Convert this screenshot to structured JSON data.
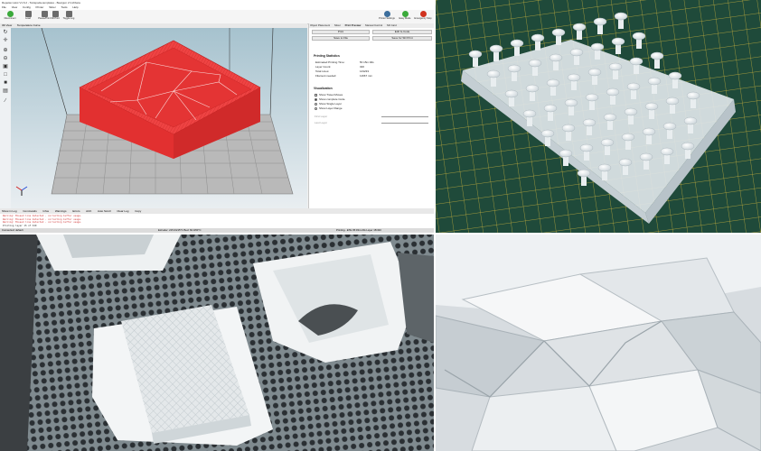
{
  "app": {
    "title": "Repetier-Host V1.6.2 - Tetrapoda-templates - Beargun 2 Inchbeta",
    "menu": [
      "File",
      "View",
      "Config",
      "Printer",
      "Slicer",
      "Tools",
      "Help"
    ],
    "toolbar": [
      {
        "label": "Disconnect",
        "icon": "power-icon",
        "color": "#3aa93a"
      },
      {
        "label": "Load",
        "icon": "folder-icon",
        "color": "#5a5a5a"
      },
      {
        "label": "Pause/Print",
        "icon": "pause-icon",
        "color": "#5a5a5a"
      },
      {
        "label": "Kill Print",
        "icon": "stop-icon",
        "color": "#5a5a5a"
      },
      {
        "label": "Toggle Log",
        "icon": "log-icon",
        "color": "#5a5a5a"
      }
    ],
    "toolbar_right": [
      {
        "label": "Printer Settings",
        "icon": "gear-icon",
        "color": "#3c6e9c"
      },
      {
        "label": "Easy Mode",
        "icon": "easy-icon",
        "color": "#3aa93a"
      },
      {
        "label": "Emergency Stop",
        "icon": "emergency-icon",
        "color": "#d0321e"
      }
    ],
    "view_tabs": [
      "3D View",
      "Temperature Curve"
    ],
    "side_tools": [
      "rotate-icon",
      "move-icon",
      "zoom-in-icon",
      "zoom-out-icon",
      "fit-icon",
      "top-view-icon",
      "front-view-icon",
      "side-view-icon",
      "parallel-icon"
    ],
    "right_tabs": [
      "Object Placement",
      "Slicer",
      "Print Preview",
      "Manual Control",
      "SD Card"
    ],
    "buttons": {
      "print": "Print",
      "edit_gcode": "Edit G-Code",
      "save_file": "Save to File",
      "save_sd": "Save for SD Print"
    },
    "stats": {
      "heading": "Printing Statistics",
      "rows": [
        {
          "label": "Estimated Printing Time:",
          "value": "5h:15m:40s"
        },
        {
          "label": "Layer Count:",
          "value": "320"
        },
        {
          "label": "Total Lines:",
          "value": "143233"
        },
        {
          "label": "Filament needed:",
          "value": "11667 mm"
        }
      ]
    },
    "visualization": {
      "heading": "Visualization",
      "options": [
        "Show Travel Moves",
        "Show complete Code",
        "Show Single Layer",
        "Show Layer Range"
      ],
      "first_layer": "First Layer",
      "last_layer": "Last Layer"
    },
    "log_tabs": [
      "Show in Log",
      "Commands",
      "Infos",
      "Warnings",
      "Errors",
      "ACK",
      "Auto Scroll",
      "Clear Log",
      "Copy"
    ],
    "log_lines": [
      "Warning: Missed line detected - correcting buffer usage.",
      "Warning: Missed line detected - correcting buffer usage.",
      "Warning: Missed line detected - correcting buffer usage.",
      "Printing layer 15 of 320"
    ],
    "status": {
      "connection": "Connected: default",
      "temps": "Extruder: 215.0/215°C Bed: 60.0/60°C",
      "progress": "Printing...ETE 05:03m:20s Layer 15/320"
    }
  },
  "colors": {
    "model": "#f03c3c",
    "model_dark": "#c62424",
    "grid_light": "#b4b4b4",
    "grid_dark": "#8a8a8a",
    "viewport_top": "#a6c2ce",
    "viewport_bottom": "#e9eef1",
    "log_text": "#d23b3b"
  }
}
